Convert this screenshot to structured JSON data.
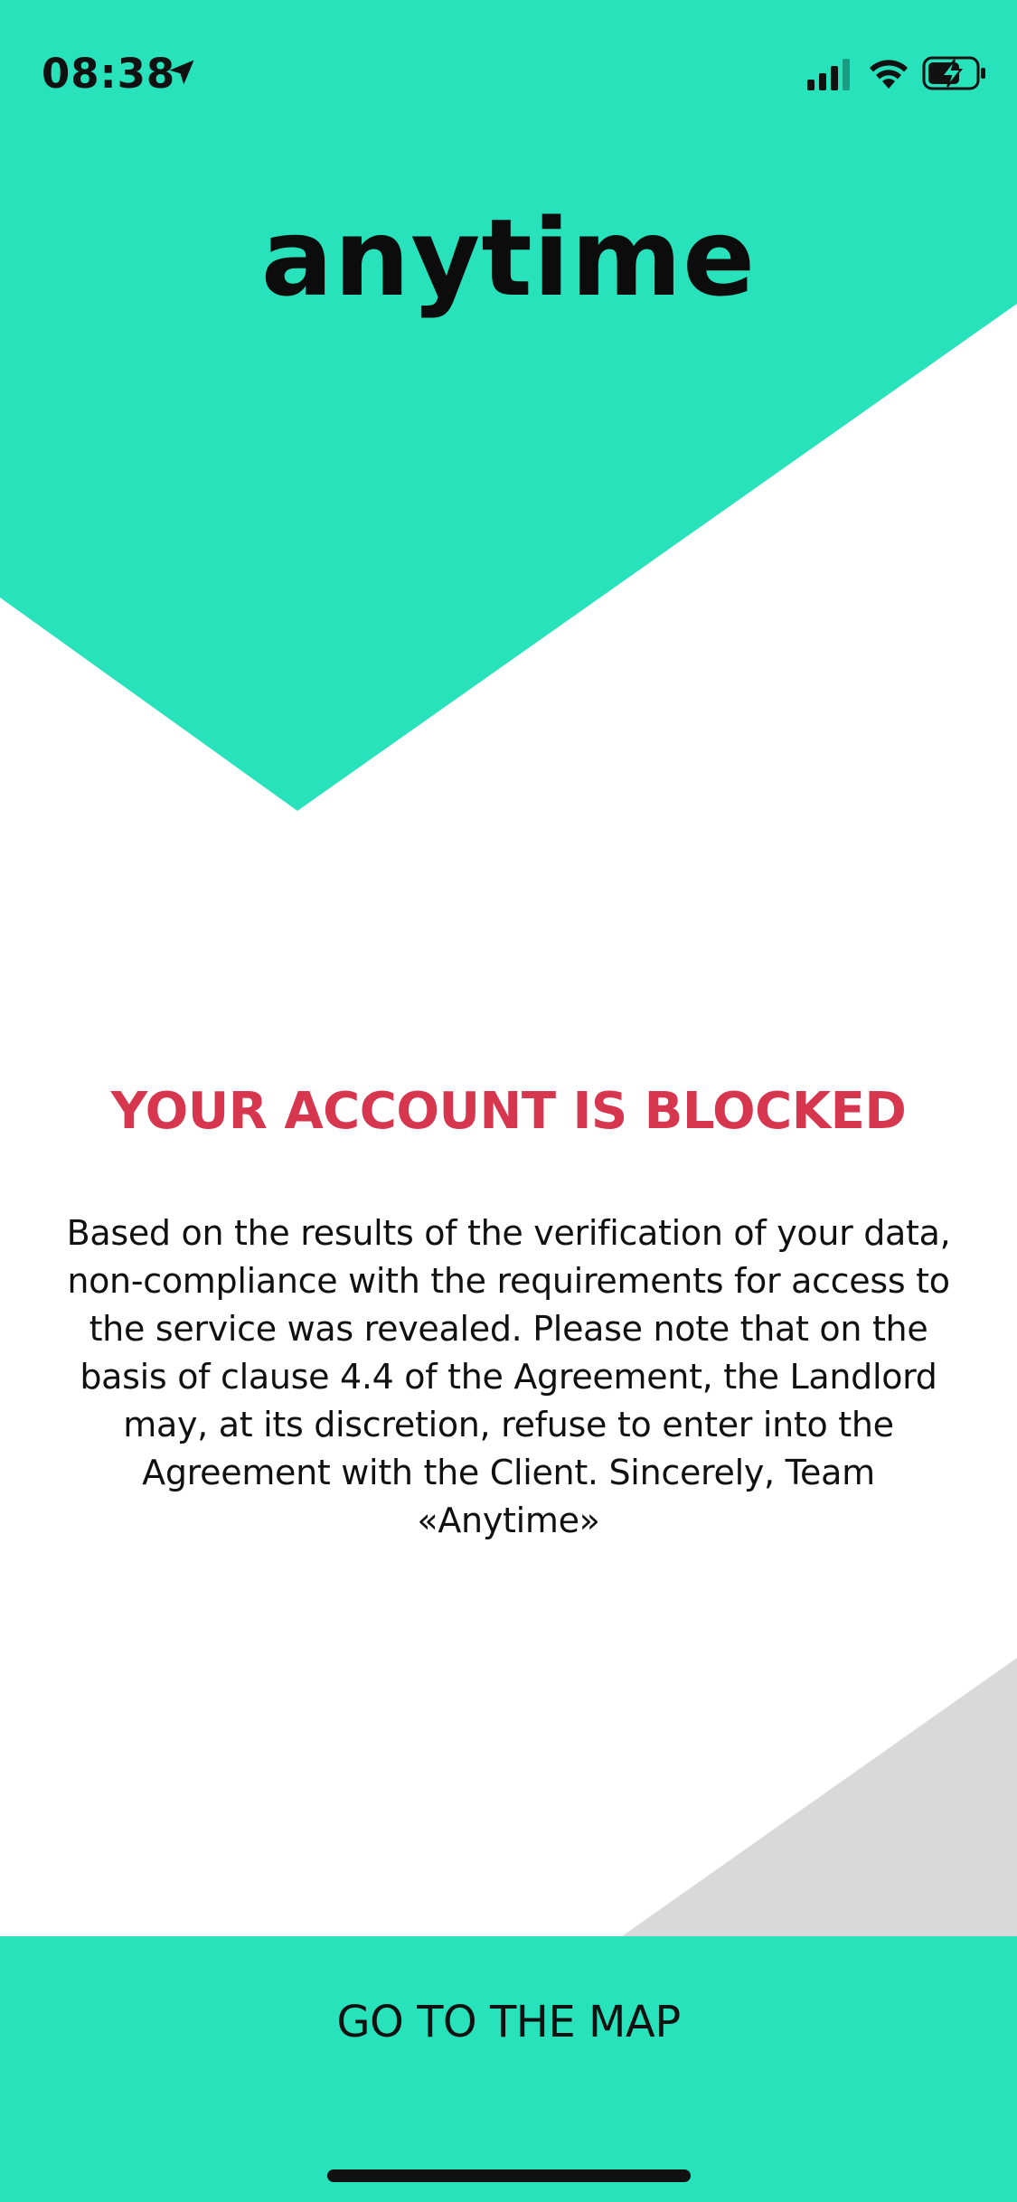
{
  "status_bar": {
    "time": "08:38",
    "location_icon": "location-arrow-icon",
    "signal_icon": "cellular-signal-icon",
    "wifi_icon": "wifi-icon",
    "battery_icon": "battery-charging-icon"
  },
  "brand": {
    "logo_text": "anytime"
  },
  "alert": {
    "title": "YOUR ACCOUNT IS BLOCKED",
    "message": "Based on the results of the verification of your data, non-compliance with the requirements for access to the service was revealed. Please note that on the basis of clause 4.4 of the Agreement, the Landlord may, at its discretion, refuse to enter into the Agreement with the Client. Sincerely, Team «Anytime»"
  },
  "actions": {
    "map_button_label": "GO TO THE MAP"
  },
  "colors": {
    "accent": "#27e2bb",
    "alert_red": "#d7364f",
    "gray_shape": "#d9d9d9",
    "text": "#111111"
  }
}
